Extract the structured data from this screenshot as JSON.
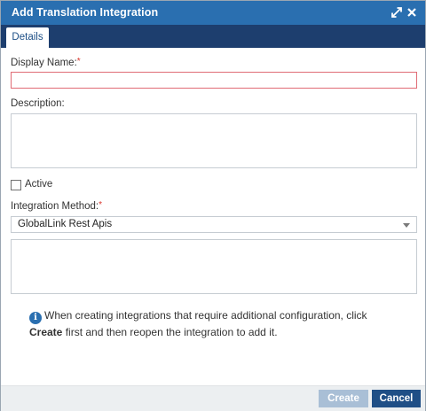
{
  "dialog": {
    "title": "Add Translation Integration",
    "icons": [
      "expand-icon",
      "close-icon"
    ]
  },
  "tabs": [
    {
      "label": "Details",
      "active": true
    }
  ],
  "form": {
    "display_name": {
      "label": "Display Name:",
      "required_mark": "*",
      "value": ""
    },
    "description": {
      "label": "Description:",
      "value": ""
    },
    "active": {
      "label": "Active",
      "checked": false
    },
    "integration_method": {
      "label": "Integration Method:",
      "required_mark": "*",
      "selected": "GlobalLink Rest Apis"
    },
    "method_config": {
      "value": ""
    }
  },
  "info": {
    "icon": "info-icon",
    "text_before": "When creating integrations that require additional configuration, click ",
    "text_bold": "Create",
    "text_after": " first and then reopen the integration to add it."
  },
  "footer": {
    "create_label": "Create",
    "cancel_label": "Cancel"
  },
  "colors": {
    "titlebar": "#2a6fb0",
    "tabstrip": "#1d3e6e",
    "required": "#d9342b",
    "invalid_border": "#e06b75",
    "primary_button": "#1f4f86",
    "disabled_button": "#a9bfd6"
  }
}
